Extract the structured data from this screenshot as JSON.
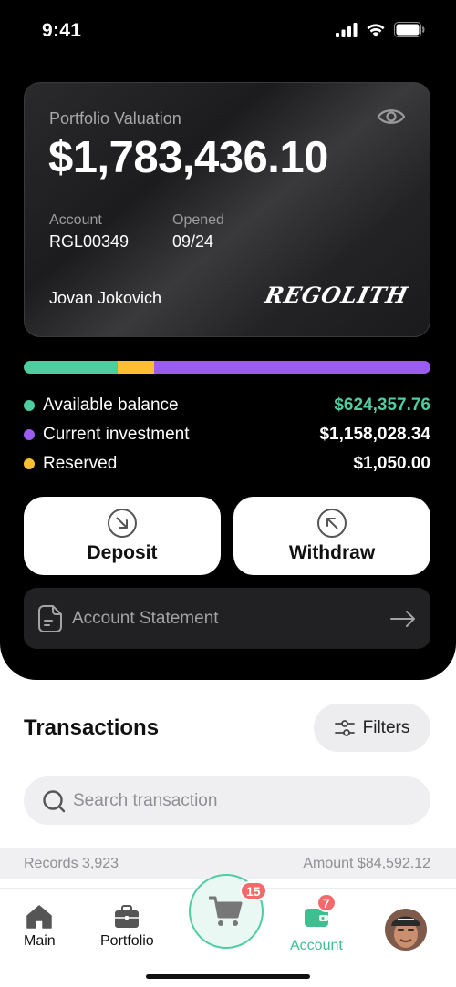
{
  "status_bar": {
    "time": "9:41"
  },
  "colors": {
    "available": "#4fcca0",
    "investment": "#9b5cf0",
    "reserved": "#fcc02e",
    "accent": "#4fcca0"
  },
  "card": {
    "label": "Portfolio Valuation",
    "value": "$1,783,436.10",
    "account_label": "Account",
    "account_value": "RGL00349",
    "opened_label": "Opened",
    "opened_value": "09/24",
    "holder": "Jovan Jokovich",
    "brand": "REGOLITH"
  },
  "allocation": {
    "segments": [
      {
        "name": "available",
        "fraction": 0.23
      },
      {
        "name": "reserved",
        "fraction": 0.09
      },
      {
        "name": "investment",
        "fraction": 0.68
      }
    ]
  },
  "legend": [
    {
      "label": "Available balance",
      "value": "$624,357.76"
    },
    {
      "label": "Current investment",
      "value": "$1,158,028.34"
    },
    {
      "label": "Reserved",
      "value": "$1,050.00"
    }
  ],
  "actions": {
    "deposit": "Deposit",
    "withdraw": "Withdraw",
    "statement": "Account Statement"
  },
  "transactions": {
    "title": "Transactions",
    "filters": "Filters",
    "search_placeholder": "Search transaction",
    "records": "Records 3,923",
    "amount": "Amount $84,592.12"
  },
  "nav": {
    "main": "Main",
    "portfolio": "Portfolio",
    "cart_badge": "15",
    "account": "Account",
    "account_badge": "7"
  }
}
